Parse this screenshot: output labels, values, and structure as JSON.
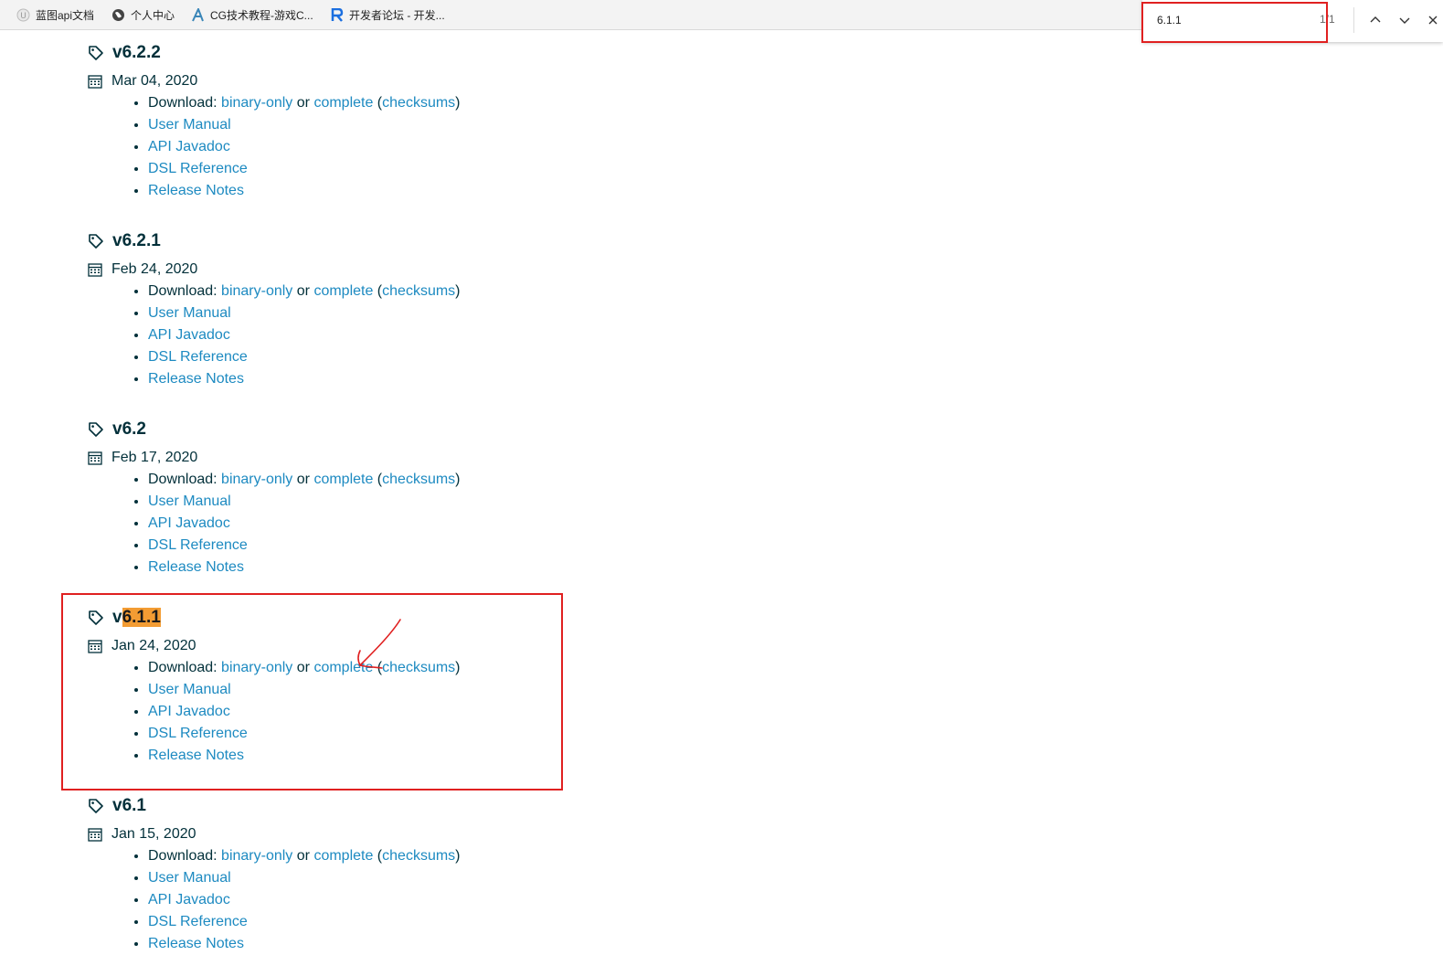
{
  "bookmarks": [
    {
      "label": "蓝图api文档",
      "icon": "unreal-icon"
    },
    {
      "label": "个人中心",
      "icon": "globe-icon"
    },
    {
      "label": "CG技术教程-游戏C...",
      "icon": "a-logo-icon"
    },
    {
      "label": "开发者论坛 - 开发...",
      "icon": "r-logo-icon"
    }
  ],
  "find": {
    "query": "6.1.1",
    "count": "1/1"
  },
  "highlight_term": "6.1.1",
  "common": {
    "download_label": "Download: ",
    "binary_only": "binary-only",
    "or": " or ",
    "complete": "complete",
    "open_paren": " (",
    "checksums": "checksums",
    "close_paren": ")",
    "user_manual": "User Manual",
    "api_javadoc": "API Javadoc",
    "dsl_reference": "DSL Reference",
    "release_notes": "Release Notes"
  },
  "releases": [
    {
      "version_prefix": "v6.2.2",
      "version_hl": "",
      "date": "Mar 04, 2020"
    },
    {
      "version_prefix": "v6.2.1",
      "version_hl": "",
      "date": "Feb 24, 2020"
    },
    {
      "version_prefix": "v6.2",
      "version_hl": "",
      "date": "Feb 17, 2020"
    },
    {
      "version_prefix": "v",
      "version_hl": "6.1.1",
      "date": "Jan 24, 2020"
    },
    {
      "version_prefix": "v6.1",
      "version_hl": "",
      "date": "Jan 15, 2020"
    }
  ]
}
